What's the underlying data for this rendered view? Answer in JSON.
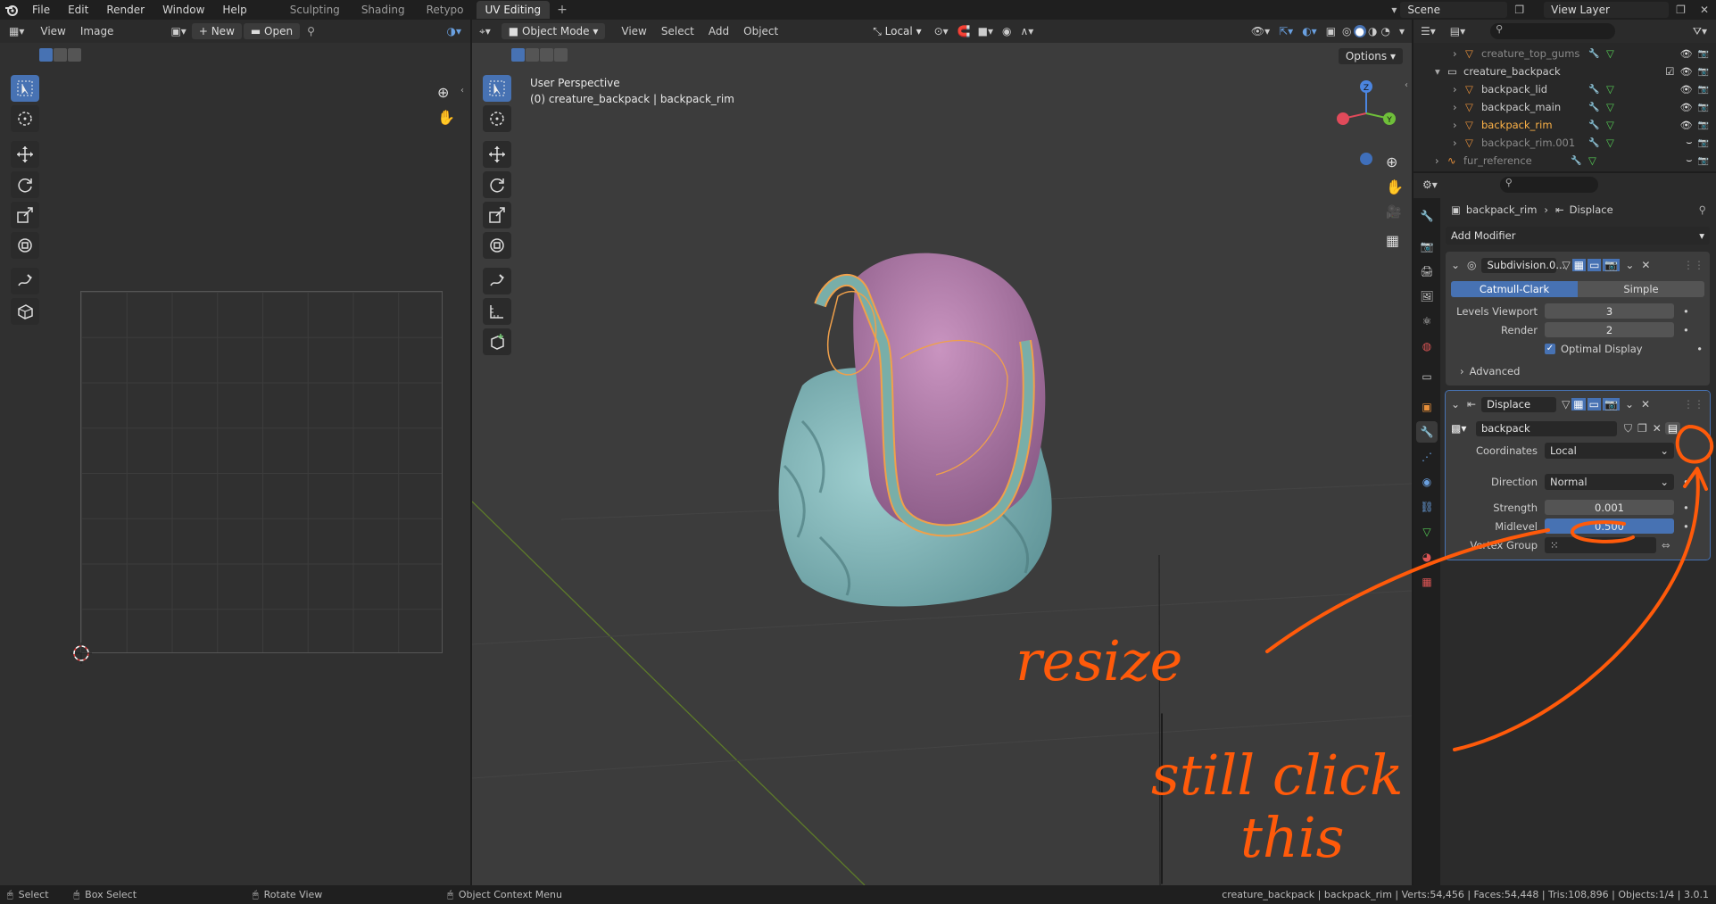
{
  "topbar": {
    "menus": [
      "File",
      "Edit",
      "Render",
      "Window",
      "Help"
    ],
    "workspaces": [
      "Sculpting",
      "Shading",
      "Retypo",
      "UV Editing"
    ],
    "active_workspace_index": 3,
    "scene_label": "Scene",
    "view_layer_label": "View Layer"
  },
  "uv_editor": {
    "menus": [
      "View",
      "Image"
    ],
    "new_label": "New",
    "open_label": "Open"
  },
  "viewport": {
    "mode_label": "Object Mode",
    "menus": [
      "View",
      "Select",
      "Add",
      "Object"
    ],
    "transform_orientation": "Local",
    "options_label": "Options",
    "overlay_line1": "User Perspective",
    "overlay_line2": "(0) creature_backpack | backpack_rim"
  },
  "outliner": {
    "items": [
      {
        "name": "creature_top_gums",
        "indent": 2,
        "state": "dim"
      },
      {
        "name": "creature_backpack",
        "indent": 1,
        "state": "normal"
      },
      {
        "name": "backpack_lid",
        "indent": 2,
        "state": "normal"
      },
      {
        "name": "backpack_main",
        "indent": 2,
        "state": "normal"
      },
      {
        "name": "backpack_rim",
        "indent": 2,
        "state": "selected"
      },
      {
        "name": "backpack_rim.001",
        "indent": 2,
        "state": "dim"
      },
      {
        "name": "fur_reference",
        "indent": 1,
        "state": "dim"
      }
    ]
  },
  "properties": {
    "breadcrumb_object": "backpack_rim",
    "breadcrumb_modifier": "Displace",
    "add_modifier_label": "Add Modifier",
    "subdivision": {
      "name": "Subdivision.0...",
      "tab_catmull": "Catmull-Clark",
      "tab_simple": "Simple",
      "levels_viewport_label": "Levels Viewport",
      "levels_viewport_value": "3",
      "render_label": "Render",
      "render_value": "2",
      "optimal_display_label": "Optimal Display",
      "advanced_label": "Advanced"
    },
    "displace": {
      "name": "Displace",
      "texture_name": "backpack",
      "coordinates_label": "Coordinates",
      "coordinates_value": "Local",
      "direction_label": "Direction",
      "direction_value": "Normal",
      "strength_label": "Strength",
      "strength_value": "0.001",
      "midlevel_label": "Midlevel",
      "midlevel_value": "0.500",
      "vertex_group_label": "Vertex Group"
    }
  },
  "annotations": {
    "resize_text": "resize",
    "still_text": "still click",
    "this_text": "this",
    "color": "#ff5a0a"
  },
  "statusbar": {
    "select_label": "Select",
    "box_select_label": "Box Select",
    "rotate_label": "Rotate View",
    "context_label": "Object Context Menu",
    "stats": "creature_backpack | backpack_rim | Verts:54,456 | Faces:54,448 | Tris:108,896 | Objects:1/4 | 3.0.1"
  },
  "colors": {
    "accent": "#4772b3",
    "selected_text": "#ffb347",
    "mesh_teal": "#7fb3b6",
    "mesh_pink": "#b17aa8",
    "outline": "#f0a04a"
  }
}
